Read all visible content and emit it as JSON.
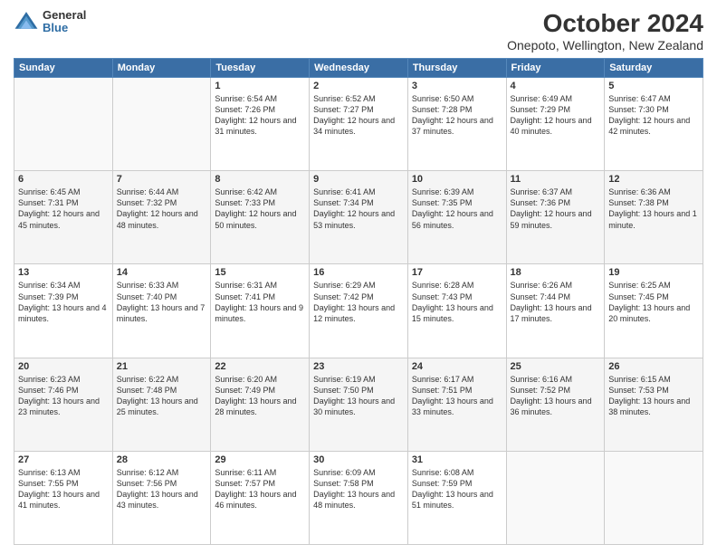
{
  "logo": {
    "general": "General",
    "blue": "Blue"
  },
  "title": "October 2024",
  "subtitle": "Onepoto, Wellington, New Zealand",
  "days_of_week": [
    "Sunday",
    "Monday",
    "Tuesday",
    "Wednesday",
    "Thursday",
    "Friday",
    "Saturday"
  ],
  "weeks": [
    [
      {
        "day": "",
        "info": ""
      },
      {
        "day": "",
        "info": ""
      },
      {
        "day": "1",
        "info": "Sunrise: 6:54 AM\nSunset: 7:26 PM\nDaylight: 12 hours and 31 minutes."
      },
      {
        "day": "2",
        "info": "Sunrise: 6:52 AM\nSunset: 7:27 PM\nDaylight: 12 hours and 34 minutes."
      },
      {
        "day": "3",
        "info": "Sunrise: 6:50 AM\nSunset: 7:28 PM\nDaylight: 12 hours and 37 minutes."
      },
      {
        "day": "4",
        "info": "Sunrise: 6:49 AM\nSunset: 7:29 PM\nDaylight: 12 hours and 40 minutes."
      },
      {
        "day": "5",
        "info": "Sunrise: 6:47 AM\nSunset: 7:30 PM\nDaylight: 12 hours and 42 minutes."
      }
    ],
    [
      {
        "day": "6",
        "info": "Sunrise: 6:45 AM\nSunset: 7:31 PM\nDaylight: 12 hours and 45 minutes."
      },
      {
        "day": "7",
        "info": "Sunrise: 6:44 AM\nSunset: 7:32 PM\nDaylight: 12 hours and 48 minutes."
      },
      {
        "day": "8",
        "info": "Sunrise: 6:42 AM\nSunset: 7:33 PM\nDaylight: 12 hours and 50 minutes."
      },
      {
        "day": "9",
        "info": "Sunrise: 6:41 AM\nSunset: 7:34 PM\nDaylight: 12 hours and 53 minutes."
      },
      {
        "day": "10",
        "info": "Sunrise: 6:39 AM\nSunset: 7:35 PM\nDaylight: 12 hours and 56 minutes."
      },
      {
        "day": "11",
        "info": "Sunrise: 6:37 AM\nSunset: 7:36 PM\nDaylight: 12 hours and 59 minutes."
      },
      {
        "day": "12",
        "info": "Sunrise: 6:36 AM\nSunset: 7:38 PM\nDaylight: 13 hours and 1 minute."
      }
    ],
    [
      {
        "day": "13",
        "info": "Sunrise: 6:34 AM\nSunset: 7:39 PM\nDaylight: 13 hours and 4 minutes."
      },
      {
        "day": "14",
        "info": "Sunrise: 6:33 AM\nSunset: 7:40 PM\nDaylight: 13 hours and 7 minutes."
      },
      {
        "day": "15",
        "info": "Sunrise: 6:31 AM\nSunset: 7:41 PM\nDaylight: 13 hours and 9 minutes."
      },
      {
        "day": "16",
        "info": "Sunrise: 6:29 AM\nSunset: 7:42 PM\nDaylight: 13 hours and 12 minutes."
      },
      {
        "day": "17",
        "info": "Sunrise: 6:28 AM\nSunset: 7:43 PM\nDaylight: 13 hours and 15 minutes."
      },
      {
        "day": "18",
        "info": "Sunrise: 6:26 AM\nSunset: 7:44 PM\nDaylight: 13 hours and 17 minutes."
      },
      {
        "day": "19",
        "info": "Sunrise: 6:25 AM\nSunset: 7:45 PM\nDaylight: 13 hours and 20 minutes."
      }
    ],
    [
      {
        "day": "20",
        "info": "Sunrise: 6:23 AM\nSunset: 7:46 PM\nDaylight: 13 hours and 23 minutes."
      },
      {
        "day": "21",
        "info": "Sunrise: 6:22 AM\nSunset: 7:48 PM\nDaylight: 13 hours and 25 minutes."
      },
      {
        "day": "22",
        "info": "Sunrise: 6:20 AM\nSunset: 7:49 PM\nDaylight: 13 hours and 28 minutes."
      },
      {
        "day": "23",
        "info": "Sunrise: 6:19 AM\nSunset: 7:50 PM\nDaylight: 13 hours and 30 minutes."
      },
      {
        "day": "24",
        "info": "Sunrise: 6:17 AM\nSunset: 7:51 PM\nDaylight: 13 hours and 33 minutes."
      },
      {
        "day": "25",
        "info": "Sunrise: 6:16 AM\nSunset: 7:52 PM\nDaylight: 13 hours and 36 minutes."
      },
      {
        "day": "26",
        "info": "Sunrise: 6:15 AM\nSunset: 7:53 PM\nDaylight: 13 hours and 38 minutes."
      }
    ],
    [
      {
        "day": "27",
        "info": "Sunrise: 6:13 AM\nSunset: 7:55 PM\nDaylight: 13 hours and 41 minutes."
      },
      {
        "day": "28",
        "info": "Sunrise: 6:12 AM\nSunset: 7:56 PM\nDaylight: 13 hours and 43 minutes."
      },
      {
        "day": "29",
        "info": "Sunrise: 6:11 AM\nSunset: 7:57 PM\nDaylight: 13 hours and 46 minutes."
      },
      {
        "day": "30",
        "info": "Sunrise: 6:09 AM\nSunset: 7:58 PM\nDaylight: 13 hours and 48 minutes."
      },
      {
        "day": "31",
        "info": "Sunrise: 6:08 AM\nSunset: 7:59 PM\nDaylight: 13 hours and 51 minutes."
      },
      {
        "day": "",
        "info": ""
      },
      {
        "day": "",
        "info": ""
      }
    ]
  ]
}
